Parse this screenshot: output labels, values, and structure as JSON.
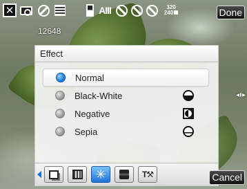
{
  "status_bar": {
    "close_icon": "close-icon",
    "camera_icon": "camera-icon",
    "flash_off_icon": "flash-off-icon",
    "quality_icon": "quality-icon",
    "battery_icon": "battery-icon",
    "signal_text": "AIII",
    "mode_icons": [
      "no-timer-icon",
      "no-mode-icon",
      "no-burst-icon"
    ],
    "resolution": {
      "top": "320",
      "bottom": "240"
    },
    "done_label": "Done"
  },
  "counter": "12648",
  "dialog": {
    "title": "Effect",
    "options": [
      {
        "label": "Normal",
        "selected": true,
        "icon": ""
      },
      {
        "label": "Black-White",
        "selected": false,
        "icon": "black-white-icon"
      },
      {
        "label": "Negative",
        "selected": false,
        "icon": "negative-icon"
      },
      {
        "label": "Sepia",
        "selected": false,
        "icon": "sepia-icon"
      }
    ]
  },
  "toolbar": {
    "tabs": [
      {
        "name": "pages-tab",
        "active": false
      },
      {
        "name": "frame-tab",
        "active": false
      },
      {
        "name": "effect-tab",
        "active": true
      },
      {
        "name": "stamp-tab",
        "active": false
      },
      {
        "name": "tools-tab",
        "active": false
      }
    ],
    "tools_glyph": "T⚒",
    "effect_glyph": "✳"
  },
  "cancel_label": "Cancel",
  "colors": {
    "accent": "#1e73d8",
    "selected_radio": "#1a7fe0"
  }
}
